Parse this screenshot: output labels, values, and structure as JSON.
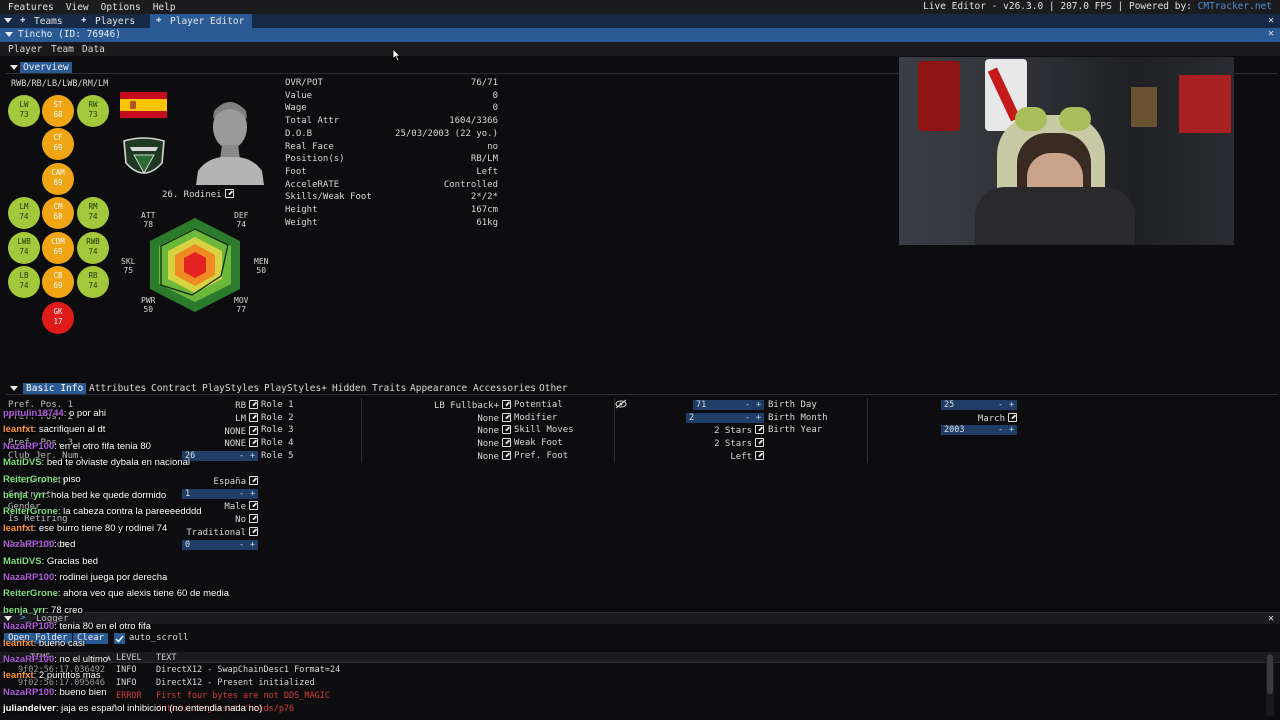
{
  "menu": [
    "Features",
    "View",
    "Options",
    "Help"
  ],
  "menu_right": {
    "text": "Live Editor - v26.3.0 | 207.0 FPS | Powered by:",
    "link": "CMTracker.net"
  },
  "tabs": [
    {
      "label": "Teams",
      "icon": "pin-icon"
    },
    {
      "label": "Players",
      "icon": "pin-icon"
    },
    {
      "label": "Player Editor",
      "icon": "pin-icon"
    }
  ],
  "window_title": "Tincho (ID: 76946)",
  "subnav": [
    "Player",
    "Team",
    "Data"
  ],
  "overview": {
    "header": "Overview",
    "positions_title": "RWB/RB/LB/LWB/RM/LM",
    "positions": [
      {
        "pos": "LW",
        "val": "73",
        "c": "g"
      },
      {
        "pos": "ST",
        "val": "68",
        "c": "o"
      },
      {
        "pos": "RW",
        "val": "73",
        "c": "g"
      },
      {
        "pos": "CF",
        "val": "69",
        "c": "o"
      },
      {
        "pos": "CAM",
        "val": "69",
        "c": "o"
      },
      {
        "pos": "LM",
        "val": "74",
        "c": "g"
      },
      {
        "pos": "CM",
        "val": "68",
        "c": "o"
      },
      {
        "pos": "RM",
        "val": "74",
        "c": "g"
      },
      {
        "pos": "LWB",
        "val": "74",
        "c": "g"
      },
      {
        "pos": "CDM",
        "val": "69",
        "c": "o"
      },
      {
        "pos": "RWB",
        "val": "74",
        "c": "g"
      },
      {
        "pos": "LB",
        "val": "74",
        "c": "g"
      },
      {
        "pos": "CB",
        "val": "69",
        "c": "o"
      },
      {
        "pos": "RB",
        "val": "74",
        "c": "g"
      },
      {
        "pos": "GK",
        "val": "17",
        "c": "r"
      }
    ],
    "player_name": "26. Rodinei",
    "radar": {
      "ATT": "78",
      "DEF": "74",
      "SKL": "75",
      "MEN": "50",
      "PWR": "50",
      "MOV": "77"
    },
    "info": [
      {
        "k": "OVR/POT",
        "v": "76/71"
      },
      {
        "k": "Value",
        "v": "0"
      },
      {
        "k": "Wage",
        "v": "0"
      },
      {
        "k": "Total Attr",
        "v": "1604/3366"
      },
      {
        "k": "D.O.B",
        "v": "25/03/2003 (22 yo.)"
      },
      {
        "k": "Real Face",
        "v": "no"
      },
      {
        "k": "Position(s)",
        "v": "RB/LM"
      },
      {
        "k": "Foot",
        "v": "Left"
      },
      {
        "k": "AcceleRATE",
        "v": "Controlled"
      },
      {
        "k": "Skills/Weak Foot",
        "v": "2*/2*"
      },
      {
        "k": "Height",
        "v": "167cm"
      },
      {
        "k": "Weight",
        "v": "61kg"
      }
    ]
  },
  "bottom_tabs": [
    "Basic Info",
    "Attributes",
    "Contract",
    "PlayStyles",
    "PlayStyles+",
    "Hidden Traits",
    "Appearance",
    "Accessories",
    "Other"
  ],
  "basic": {
    "left_labels": [
      "Pref. Pos. 1",
      "Pref. Pos. 2",
      "Pref. Pos. 3",
      "Club Jer. Num.",
      "Nationality",
      "Contract",
      "Gender",
      "Is Retiring",
      "Celebration"
    ],
    "left_values": [
      "RB",
      "LM",
      "NONE",
      "NONE",
      "26",
      "España",
      "1",
      "Male",
      "No",
      "Traditional",
      "0"
    ],
    "roles": [
      {
        "k": "Role 1",
        "v": "LB Fullback+"
      },
      {
        "k": "Role 2",
        "v": "None"
      },
      {
        "k": "Role 3",
        "v": "None"
      },
      {
        "k": "Role 4",
        "v": "None"
      },
      {
        "k": "Role 5",
        "v": "None"
      }
    ],
    "skills": [
      {
        "k": "Potential",
        "v": "71"
      },
      {
        "k": "Modifier",
        "v": "2"
      },
      {
        "k": "Skill Moves",
        "v": "2 Stars"
      },
      {
        "k": "Weak Foot",
        "v": "2 Stars"
      },
      {
        "k": "Pref. Foot",
        "v": "Left"
      }
    ],
    "birth": [
      {
        "k": "Birth Day",
        "v": "25"
      },
      {
        "k": "Birth Month",
        "v": "March"
      },
      {
        "k": "Birth Year",
        "v": "2003"
      }
    ]
  },
  "chat": [
    {
      "u": "ppitulin18744",
      "m": ": o por ahi",
      "c": "#b25ce0"
    },
    {
      "u": "leanfxt",
      "m": ": sacrifiquen al dt",
      "c": "#ff9933"
    },
    {
      "u": "NazaRP100",
      "m": ": en el otro fifa tenia 80",
      "c": "#b25ce0"
    },
    {
      "u": "MatiDVS",
      "m": ": bed te olviaste dybala en nacional",
      "c": "#7ee07e"
    },
    {
      "u": "ReiterGrone",
      "m": ": piso",
      "c": "#7ee07e"
    },
    {
      "u": "benja_yrr",
      "m": ": hola bed ke quede dormido",
      "c": "#7ee07e"
    },
    {
      "u": "ReiterGrone",
      "m": ": la cabeza contra la pareeeedddd",
      "c": "#7ee07e"
    },
    {
      "u": "leanfxt",
      "m": ": ese burro tiene 80 y rodinei 74",
      "c": "#ff9933"
    },
    {
      "u": "NazaRP100",
      "m": ": bed",
      "c": "#b25ce0"
    },
    {
      "u": "MatiDVS",
      "m": ": Gracias bed",
      "c": "#7ee07e"
    },
    {
      "u": "NazaRP100",
      "m": ": rodinei juega por derecha",
      "c": "#b25ce0"
    },
    {
      "u": "ReiterGrone",
      "m": ": ahora veo que alexis tiene 60 de media",
      "c": "#7ee07e"
    },
    {
      "u": "benja_yrr",
      "m": ": 78 creo",
      "c": "#7ee07e"
    },
    {
      "u": "NazaRP100",
      "m": ": tenia 80 en el otro fifa",
      "c": "#b25ce0"
    },
    {
      "u": "leanfxt",
      "m": ": bueno casi",
      "c": "#ff9933"
    },
    {
      "u": "NazaRP100",
      "m": ": no el ultimo",
      "c": "#b25ce0"
    },
    {
      "u": "leanfxt",
      "m": ": 2 puntitos mas",
      "c": "#ff9933"
    },
    {
      "u": "NazaRP100",
      "m": ": bueno bien",
      "c": "#b25ce0"
    },
    {
      "u": "juliandeiver",
      "m": ": jaja es español inhibicion (no entendia nada no)",
      "c": "#ffffff"
    }
  ],
  "logger": {
    "title": "Logger",
    "open_folder": "Open Folder",
    "clear": "Clear",
    "auto_scroll": "auto_scroll",
    "cols": [
      "TIME",
      "LEVEL",
      "TEXT"
    ],
    "rows": [
      {
        "time": "9f02:56:17.036492",
        "level": "INFO",
        "text": "DirectX12 - SwapChainDesc1 Format=24",
        "c": "#d8d8d8"
      },
      {
        "time": "9f02:56:17.095046",
        "level": "INFO",
        "text": "DirectX12 - Present initialized",
        "c": "#d8d8d8"
      },
      {
        "time": "",
        "level": "ERROR",
        "text": "First four bytes are not DDS_MAGIC",
        "c": "#d43b3b"
      },
      {
        "time": "",
        "level": "",
        "text": "data/ui/imgAssets/heads/p76",
        "c": "#d43b3b"
      }
    ]
  },
  "colors": {
    "accent": "#2a5a93",
    "tab_bar": "#152a47",
    "green": "#a4c83b",
    "orange": "#f0a514",
    "red": "#e01919"
  }
}
